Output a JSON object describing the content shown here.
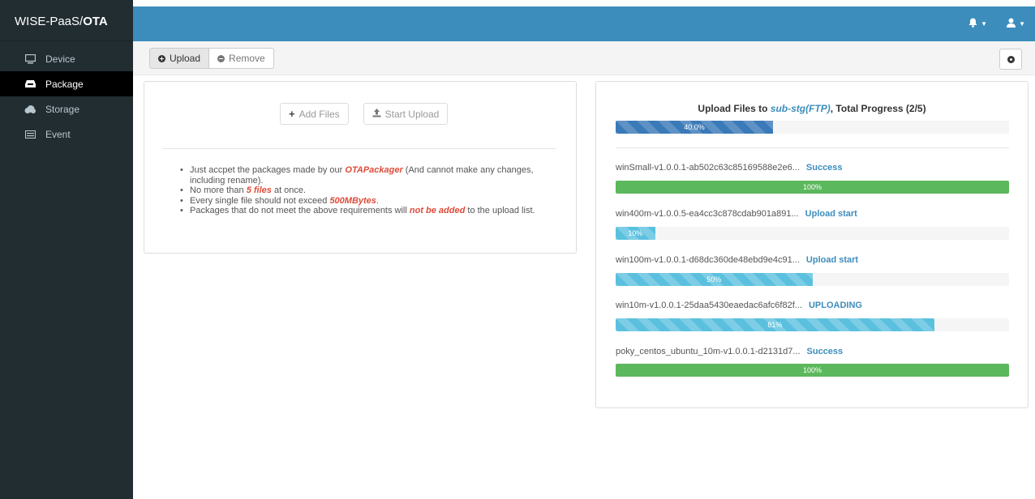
{
  "brand": {
    "prefix": "WISE-PaaS/",
    "suffix": "OTA"
  },
  "sidebar": {
    "items": [
      {
        "label": "Device",
        "icon": "monitor-icon"
      },
      {
        "label": "Package",
        "icon": "inbox-icon",
        "active": true
      },
      {
        "label": "Storage",
        "icon": "cloud-icon"
      },
      {
        "label": "Event",
        "icon": "list-icon"
      }
    ]
  },
  "toolbar": {
    "upload_label": "Upload",
    "remove_label": "Remove"
  },
  "left_panel": {
    "add_files_label": "Add Files",
    "start_upload_label": "Start Upload",
    "rules": {
      "r1_a": "Just accpet the packages made by our ",
      "r1_hl": "OTAPackager",
      "r1_b": " (And cannot make any changes, including rename).",
      "r2_a": "No more than ",
      "r2_hl": "5 files",
      "r2_b": " at once.",
      "r3_a": "Every single file should not exceed ",
      "r3_hl": "500MBytes",
      "r3_b": ".",
      "r4_a": "Packages that do not meet the above requirements will ",
      "r4_hl": "not be added",
      "r4_b": " to the upload list."
    }
  },
  "right_panel": {
    "title_prefix": "Upload Files to ",
    "target": "sub-stg(FTP)",
    "title_suffix": ", Total Progress (2/5)",
    "total_progress": {
      "value": 40,
      "label": "40.0%"
    },
    "files": [
      {
        "name": "winSmall-v1.0.0.1-ab502c63c85169588e2e6...",
        "status": "Success",
        "progress": 100,
        "label": "100%",
        "style": "green"
      },
      {
        "name": "win400m-v1.0.0.5-ea4cc3c878cdab901a891...",
        "status": "Upload start",
        "progress": 10,
        "label": "10%",
        "style": "blue-striped"
      },
      {
        "name": "win100m-v1.0.0.1-d68dc360de48ebd9e4c91...",
        "status": "Upload start",
        "progress": 50,
        "label": "50%",
        "style": "blue-striped"
      },
      {
        "name": "win10m-v1.0.0.1-25daa5430eaedac6afc6f82f...",
        "status": "UPLOADING",
        "progress": 81,
        "label": "81%",
        "style": "blue-striped"
      },
      {
        "name": "poky_centos_ubuntu_10m-v1.0.0.1-d2131d7...",
        "status": "Success",
        "progress": 100,
        "label": "100%",
        "style": "green"
      }
    ]
  },
  "colors": {
    "sidebar_bg": "#222d32",
    "topbar_bg": "#3c8dbc",
    "success": "#5cb85c",
    "info": "#5bc0de",
    "highlight": "#dd4b39"
  }
}
